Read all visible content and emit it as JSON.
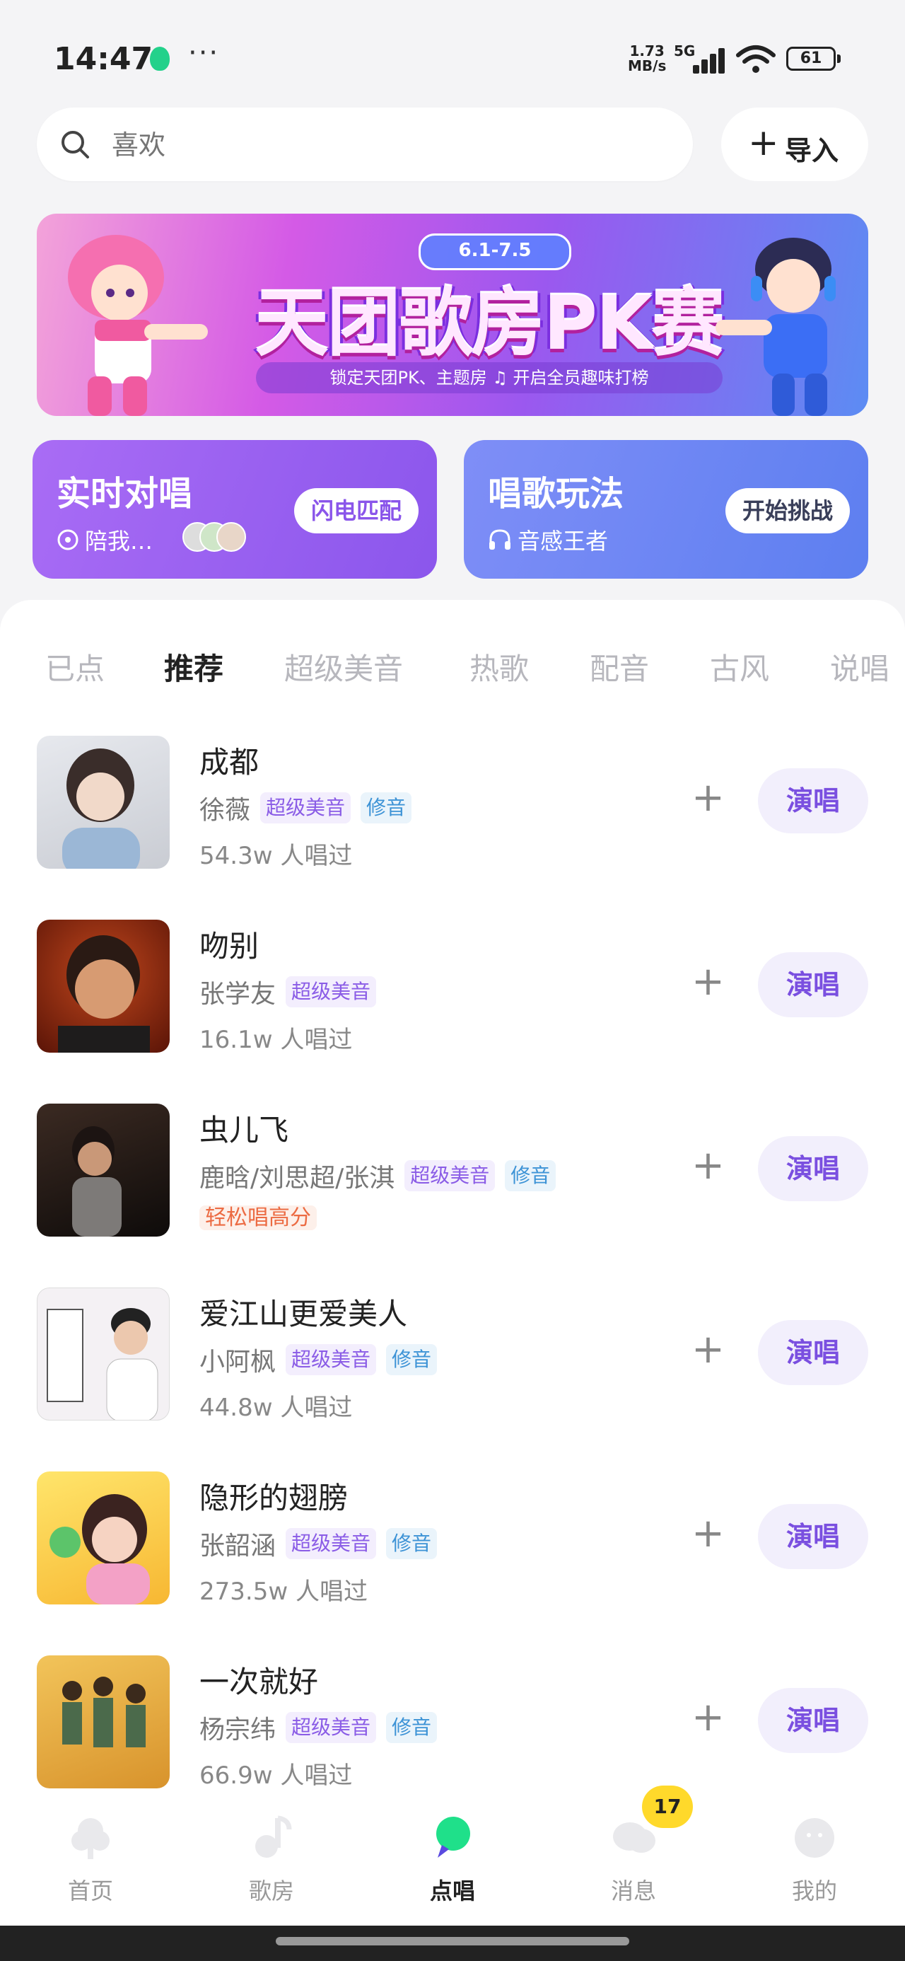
{
  "status": {
    "time": "14:47",
    "net_speed_top": "1.73",
    "net_speed_bottom": "MB/s",
    "network": "5G",
    "battery": "61"
  },
  "search": {
    "placeholder": "喜欢",
    "import_label": "导入"
  },
  "banner": {
    "date": "6.1-7.5",
    "title": "天团歌房PK赛",
    "subtitle": "锁定天团PK、主题房 ♫ 开启全员趣味打榜"
  },
  "cards": [
    {
      "title": "实时对唱",
      "subtitle": "陪我…",
      "button": "闪电匹配"
    },
    {
      "title": "唱歌玩法",
      "subtitle": "音感王者",
      "button": "开始挑战"
    }
  ],
  "tabs": [
    "已点",
    "推荐",
    "超级美音",
    "热歌",
    "配音",
    "古风",
    "说唱"
  ],
  "active_tab": "推荐",
  "songs": [
    {
      "name": "成都",
      "artist": "徐薇",
      "tags": [
        "超级美音",
        "修音"
      ],
      "count": "54.3w 人唱过",
      "action": "演唱"
    },
    {
      "name": "吻别",
      "artist": "张学友",
      "tags": [
        "超级美音"
      ],
      "count": "16.1w 人唱过",
      "action": "演唱"
    },
    {
      "name": "虫儿飞",
      "artist": "鹿晗/刘思超/张淇",
      "tags": [
        "超级美音",
        "修音"
      ],
      "extra_tag": "轻松唱高分",
      "action": "演唱"
    },
    {
      "name": "爱江山更爱美人",
      "artist": "小阿枫",
      "tags": [
        "超级美音",
        "修音"
      ],
      "count": "44.8w 人唱过",
      "action": "演唱"
    },
    {
      "name": "隐形的翅膀",
      "artist": "张韶涵",
      "tags": [
        "超级美音",
        "修音"
      ],
      "count": "273.5w 人唱过",
      "action": "演唱"
    },
    {
      "name": "一次就好",
      "artist": "杨宗纬",
      "tags": [
        "超级美音",
        "修音"
      ],
      "count": "66.9w 人唱过",
      "action": "演唱"
    }
  ],
  "tabbar": {
    "items": [
      "首页",
      "歌房",
      "点唱",
      "消息",
      "我的"
    ],
    "active": "点唱",
    "message_badge": "17"
  },
  "colors": {
    "accent": "#7a4fe0",
    "active_tab_icon": "#1fe08a",
    "badge": "#ffd92b"
  }
}
